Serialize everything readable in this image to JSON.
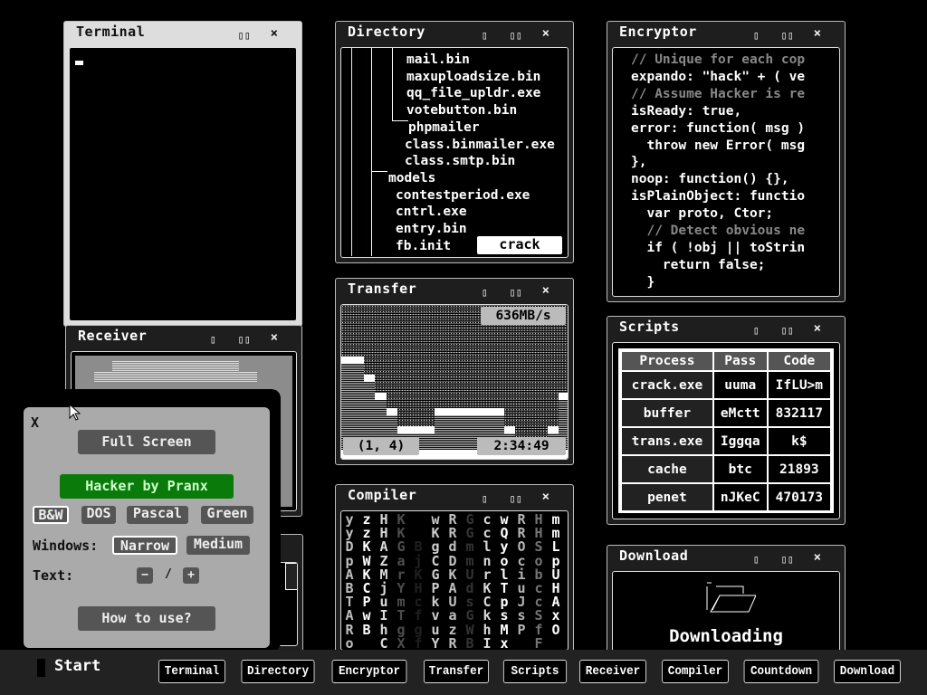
{
  "windows": {
    "terminal": {
      "title": "Terminal",
      "maximize": "▯▯",
      "close": "×"
    },
    "receiver": {
      "title": "Receiver",
      "minimize": "▯",
      "maximize": "▯▯",
      "close": "×"
    },
    "directory": {
      "title": "Directory",
      "minimize": "▯",
      "maximize": "▯▯",
      "close": "×",
      "items": [
        "mail.bin",
        "maxuploadsize.bin",
        "qq_file_upldr.exe",
        "votebutton.bin",
        "phpmailer",
        "class.binmailer.exe",
        "class.smtp.bin",
        "models",
        "contestperiod.exe",
        "cntrl.exe",
        "entry.bin",
        "fb.init"
      ],
      "action_label": "crack"
    },
    "transfer": {
      "title": "Transfer",
      "minimize": "▯",
      "maximize": "▯▯",
      "close": "×",
      "speed": "636MB/s",
      "coords": "(1, 4)",
      "elapsed": "2:34:49"
    },
    "compiler": {
      "title": "Compiler",
      "minimize": "▯",
      "maximize": "▯▯",
      "close": "×",
      "columns": [
        "yyDpABTARo",
        "zzKWKCPwB",
        "HHAZMjuIhC",
        "KKGarYmTgX",
        "  BjKHcfgf",
        "wKgCGPkvuY",
        "RRdDKAUazR",
        "GGmmUdsGWB",
        "cclnrKCkhI",
        "wQyolTpsMx",
        "RROciuJsP",
        "HHSobccSfF",
        "mmLpUHAxO"
      ]
    },
    "encryptor": {
      "title": "Encryptor",
      "minimize": "▯",
      "maximize": "▯▯",
      "close": "×",
      "lines": [
        {
          "text": "// Unique for each cop",
          "comment": true
        },
        {
          "text": "expando: \"hack\" + ( ve",
          "comment": false
        },
        {
          "text": "// Assume Hacker is re",
          "comment": true
        },
        {
          "text": "isReady: true,",
          "comment": false
        },
        {
          "text": "error: function( msg )",
          "comment": false
        },
        {
          "text": "  throw new Error( msg",
          "comment": false
        },
        {
          "text": "},",
          "comment": false
        },
        {
          "text": "noop: function() {},",
          "comment": false
        },
        {
          "text": "isPlainObject: functio",
          "comment": false
        },
        {
          "text": "  var proto, Ctor;",
          "comment": false
        },
        {
          "text": "  // Detect obvious ne",
          "comment": true
        },
        {
          "text": "  if ( !obj || toStrin",
          "comment": false
        },
        {
          "text": "    return false;",
          "comment": false
        },
        {
          "text": "  }",
          "comment": false
        }
      ]
    },
    "scripts": {
      "title": "Scripts",
      "minimize": "▯",
      "maximize": "▯▯",
      "close": "×",
      "headers": [
        "Process",
        "Pass",
        "Code"
      ],
      "rows": [
        [
          "crack.exe",
          "uuma",
          "IfLU>m"
        ],
        [
          "buffer",
          "eMctt",
          "832117"
        ],
        [
          "trans.exe",
          "Iggqa",
          "k$"
        ],
        [
          "cache",
          "btc",
          "21893"
        ],
        [
          "penet",
          "nJKeC",
          "470173"
        ]
      ]
    },
    "download": {
      "title": "Download",
      "minimize": "▯",
      "maximize": "▯▯",
      "close": "×",
      "status": "Downloading"
    }
  },
  "settings": {
    "close": "X",
    "full_screen": "Full Screen",
    "brand": "Hacker by Pranx",
    "themes": [
      "B&W",
      "DOS",
      "Pascal",
      "Green"
    ],
    "selected_theme": "B&W",
    "windows_label": "Windows:",
    "window_sizes": [
      "Narrow",
      "Medium"
    ],
    "selected_window_size": "Narrow",
    "text_label": "Text:",
    "text_minus": "−",
    "text_sep": "/",
    "text_plus": "+",
    "how_to": "How to use?",
    "brand_color": "#0a7a0a"
  },
  "taskbar": {
    "start": "Start",
    "items": [
      "Terminal",
      "Directory",
      "Encryptor",
      "Transfer",
      "Scripts",
      "Receiver",
      "Compiler",
      "Countdown",
      "Download"
    ]
  }
}
